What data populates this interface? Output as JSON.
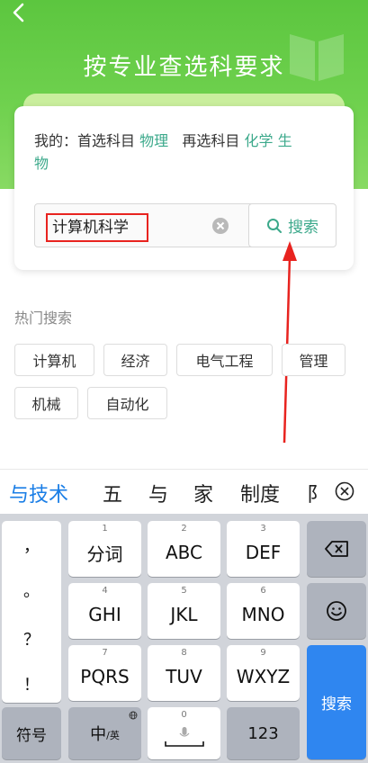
{
  "header": {
    "title": "按专业查选科要求"
  },
  "card": {
    "label_mine": "我的：",
    "label_first": "首选科目",
    "first_subject": "物理",
    "label_second": "再选科目",
    "second_subject_1": "化学",
    "second_subject_2": "生",
    "second_subject_wrap": "物"
  },
  "search": {
    "value": "计算机科学",
    "button_label": "搜索"
  },
  "hot": {
    "title": "热门搜索",
    "tags": [
      "计算机",
      "经济",
      "电气工程",
      "管理",
      "机械",
      "自动化"
    ]
  },
  "candidates": [
    "与技术",
    "五",
    "与",
    "家",
    "制度",
    "阝"
  ],
  "keyboard": {
    "punct": [
      "，",
      "。",
      "？",
      "！"
    ],
    "keys": [
      {
        "num": "1",
        "label": "分词"
      },
      {
        "num": "2",
        "label": "ABC"
      },
      {
        "num": "3",
        "label": "DEF"
      },
      {
        "num": "4",
        "label": "GHI"
      },
      {
        "num": "5",
        "label": "JKL"
      },
      {
        "num": "6",
        "label": "MNO"
      },
      {
        "num": "7",
        "label": "PQRS"
      },
      {
        "num": "8",
        "label": "TUV"
      },
      {
        "num": "9",
        "label": "WXYZ"
      }
    ],
    "symbol": "符号",
    "lang_main": "中",
    "lang_sub": "/英",
    "space_num": "0",
    "numbers": "123",
    "search": "搜索"
  },
  "colors": {
    "accent_green": "#3ca98b",
    "header_green": "#5cc63f",
    "highlight_red": "#e8231f",
    "ime_blue": "#2f86f0"
  }
}
